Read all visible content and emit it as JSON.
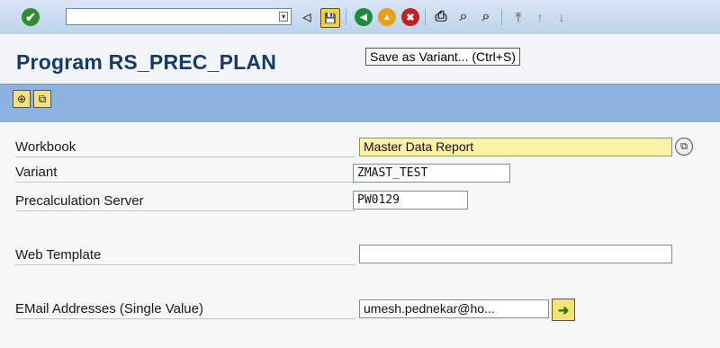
{
  "toolbar": {
    "enter_icon": "✔",
    "command_field_value": "",
    "dropdown_icon": "▾",
    "back_icon": "◁",
    "save_icon": "💾",
    "nav_back_icon": "◀",
    "exit_icon": "▲",
    "cancel_icon": "✖",
    "print_icon": "⎙",
    "find_icon": "⌕",
    "find_next_icon": "⌕",
    "first_page_icon": "⤒",
    "prev_page_icon": "↑",
    "next_page_icon": "↓"
  },
  "header": {
    "title": "Program RS_PREC_PLAN",
    "tooltip": "Save as Variant...  (Ctrl+S)"
  },
  "app_toolbar": {
    "execute_icon": "⊕",
    "get_variant_icon": "⧉"
  },
  "form": {
    "workbook_label": "Workbook",
    "workbook_value": "Master Data Report",
    "variant_label": "Variant",
    "variant_value": "ZMAST_TEST",
    "server_label": "Precalculation Server",
    "server_value": "PW0129",
    "web_template_label": "Web Template",
    "web_template_value": "",
    "email_label": "EMail Addresses (Single Value)",
    "email_value": "umesh.pednekar@ho...",
    "f4_icon": "⧉",
    "multiple_selection_icon": "➜"
  }
}
